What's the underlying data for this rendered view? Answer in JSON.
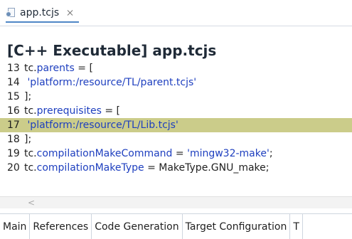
{
  "editor_tab": {
    "title": "app.tcjs",
    "close_symbol": "⌘"
  },
  "header": {
    "title": "[C++ Executable] app.tcjs"
  },
  "code": {
    "lines": [
      {
        "num": "13",
        "segments": [
          {
            "cls": "t-plain",
            "text": "tc."
          },
          {
            "cls": "t-prop",
            "text": "parents"
          },
          {
            "cls": "t-plain",
            "text": " = ["
          }
        ]
      },
      {
        "num": "14",
        "segments": [
          {
            "cls": "t-plain",
            "text": "  "
          },
          {
            "cls": "t-str",
            "text": "'platform:/resource/TL/parent.tcjs'"
          }
        ]
      },
      {
        "num": "15",
        "segments": [
          {
            "cls": "t-plain",
            "text": "];"
          }
        ]
      },
      {
        "num": "16",
        "segments": [
          {
            "cls": "t-plain",
            "text": "tc."
          },
          {
            "cls": "t-prop",
            "text": "prerequisites"
          },
          {
            "cls": "t-plain",
            "text": " = ["
          }
        ]
      },
      {
        "num": "17",
        "segments": [
          {
            "cls": "t-plain",
            "text": "  "
          },
          {
            "cls": "t-str",
            "text": "'platform:/resource/TL/Lib.tcjs'"
          }
        ],
        "highlight": true
      },
      {
        "num": "18",
        "segments": [
          {
            "cls": "t-plain",
            "text": "];"
          }
        ]
      },
      {
        "num": "19",
        "segments": [
          {
            "cls": "t-plain",
            "text": "tc."
          },
          {
            "cls": "t-prop",
            "text": "compilationMakeCommand"
          },
          {
            "cls": "t-plain",
            "text": " = "
          },
          {
            "cls": "t-str",
            "text": "'mingw32-make'"
          },
          {
            "cls": "t-plain",
            "text": ";"
          }
        ]
      },
      {
        "num": "20",
        "segments": [
          {
            "cls": "t-plain",
            "text": "tc."
          },
          {
            "cls": "t-prop",
            "text": "compilationMakeType"
          },
          {
            "cls": "t-plain",
            "text": " = MakeType.GNU_make;"
          }
        ]
      }
    ]
  },
  "scrollbar": {
    "left_arrow": "<"
  },
  "bottom_tabs": [
    {
      "label": "Main"
    },
    {
      "label": "References"
    },
    {
      "label": "Code Generation"
    },
    {
      "label": "Target Configuration"
    },
    {
      "label": "T"
    }
  ],
  "colors": {
    "highlight": "#cbcc8a",
    "keyword": "#1e3fbf"
  },
  "icons": {
    "editor_file": "tcjs-file-icon",
    "close": "close-icon"
  }
}
